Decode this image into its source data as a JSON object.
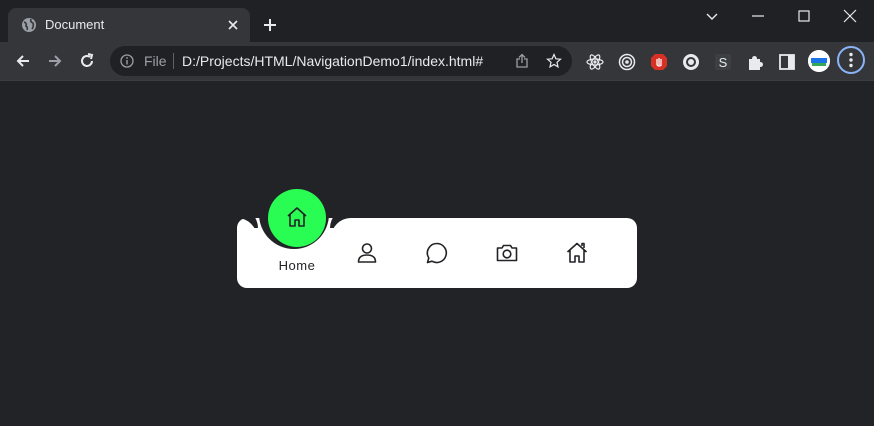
{
  "browser": {
    "tab": {
      "title": "Document",
      "icon": "globe-icon"
    },
    "omnibox": {
      "scheme": "File",
      "url": "D:/Projects/HTML/NavigationDemo1/index.html#"
    },
    "extensions": [
      "react-devtools-icon",
      "target-icon",
      "stop-hand-icon",
      "chatgpt-icon",
      "s-extension-icon",
      "puzzle-icon",
      "side-panel-icon"
    ],
    "colors": {
      "frame": "#202124",
      "toolbar": "#35363a",
      "accent": "#8ab4f8"
    }
  },
  "page": {
    "background": "#222327",
    "navigation": {
      "active_index": 0,
      "accent": "#29fd53",
      "items": [
        {
          "label": "Home",
          "icon": "home-icon"
        },
        {
          "label": "",
          "icon": "user-icon"
        },
        {
          "label": "",
          "icon": "message-icon"
        },
        {
          "label": "",
          "icon": "camera-icon"
        },
        {
          "label": "",
          "icon": "home-icon"
        }
      ]
    }
  }
}
